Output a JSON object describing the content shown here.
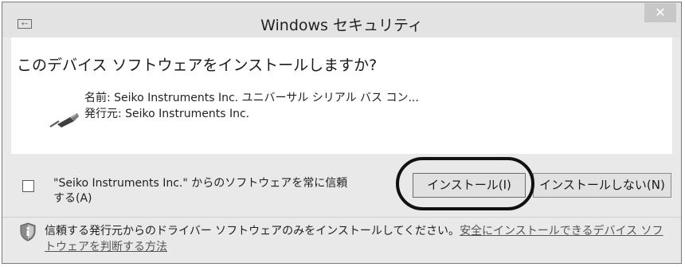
{
  "window": {
    "title": "Windows セキュリティ",
    "system_icon_glyph": "+−",
    "close_glyph": "✕"
  },
  "dialog": {
    "question": "このデバイス ソフトウェアをインストールしますか?",
    "name_line": "名前: Seiko Instruments Inc. ユニバーサル シリアル バス コン...",
    "publisher_line": "発行元: Seiko Instruments Inc.",
    "always_trust_label": "\"Seiko Instruments Inc.\" からのソフトウェアを常に信頼する(A)",
    "always_trust_checked": false,
    "install_button": "インストール(I)",
    "dont_install_button": "インストールしない(N)",
    "note_text": "信頼する発行元からのドライバー ソフトウェアのみをインストールしてください。",
    "note_link": "安全にインストールできるデバイス ソフトウェアを判断する方法"
  },
  "icons": {
    "window_icon": "window-system-icon",
    "device": "usb-cable-icon",
    "note": "shield-info-icon"
  },
  "colors": {
    "title_bar": "#e3e3e3",
    "footer": "#e9e9e9",
    "content": "#ffffff",
    "close_button": "#c7c7c7",
    "highlight_ring": "#111111"
  }
}
